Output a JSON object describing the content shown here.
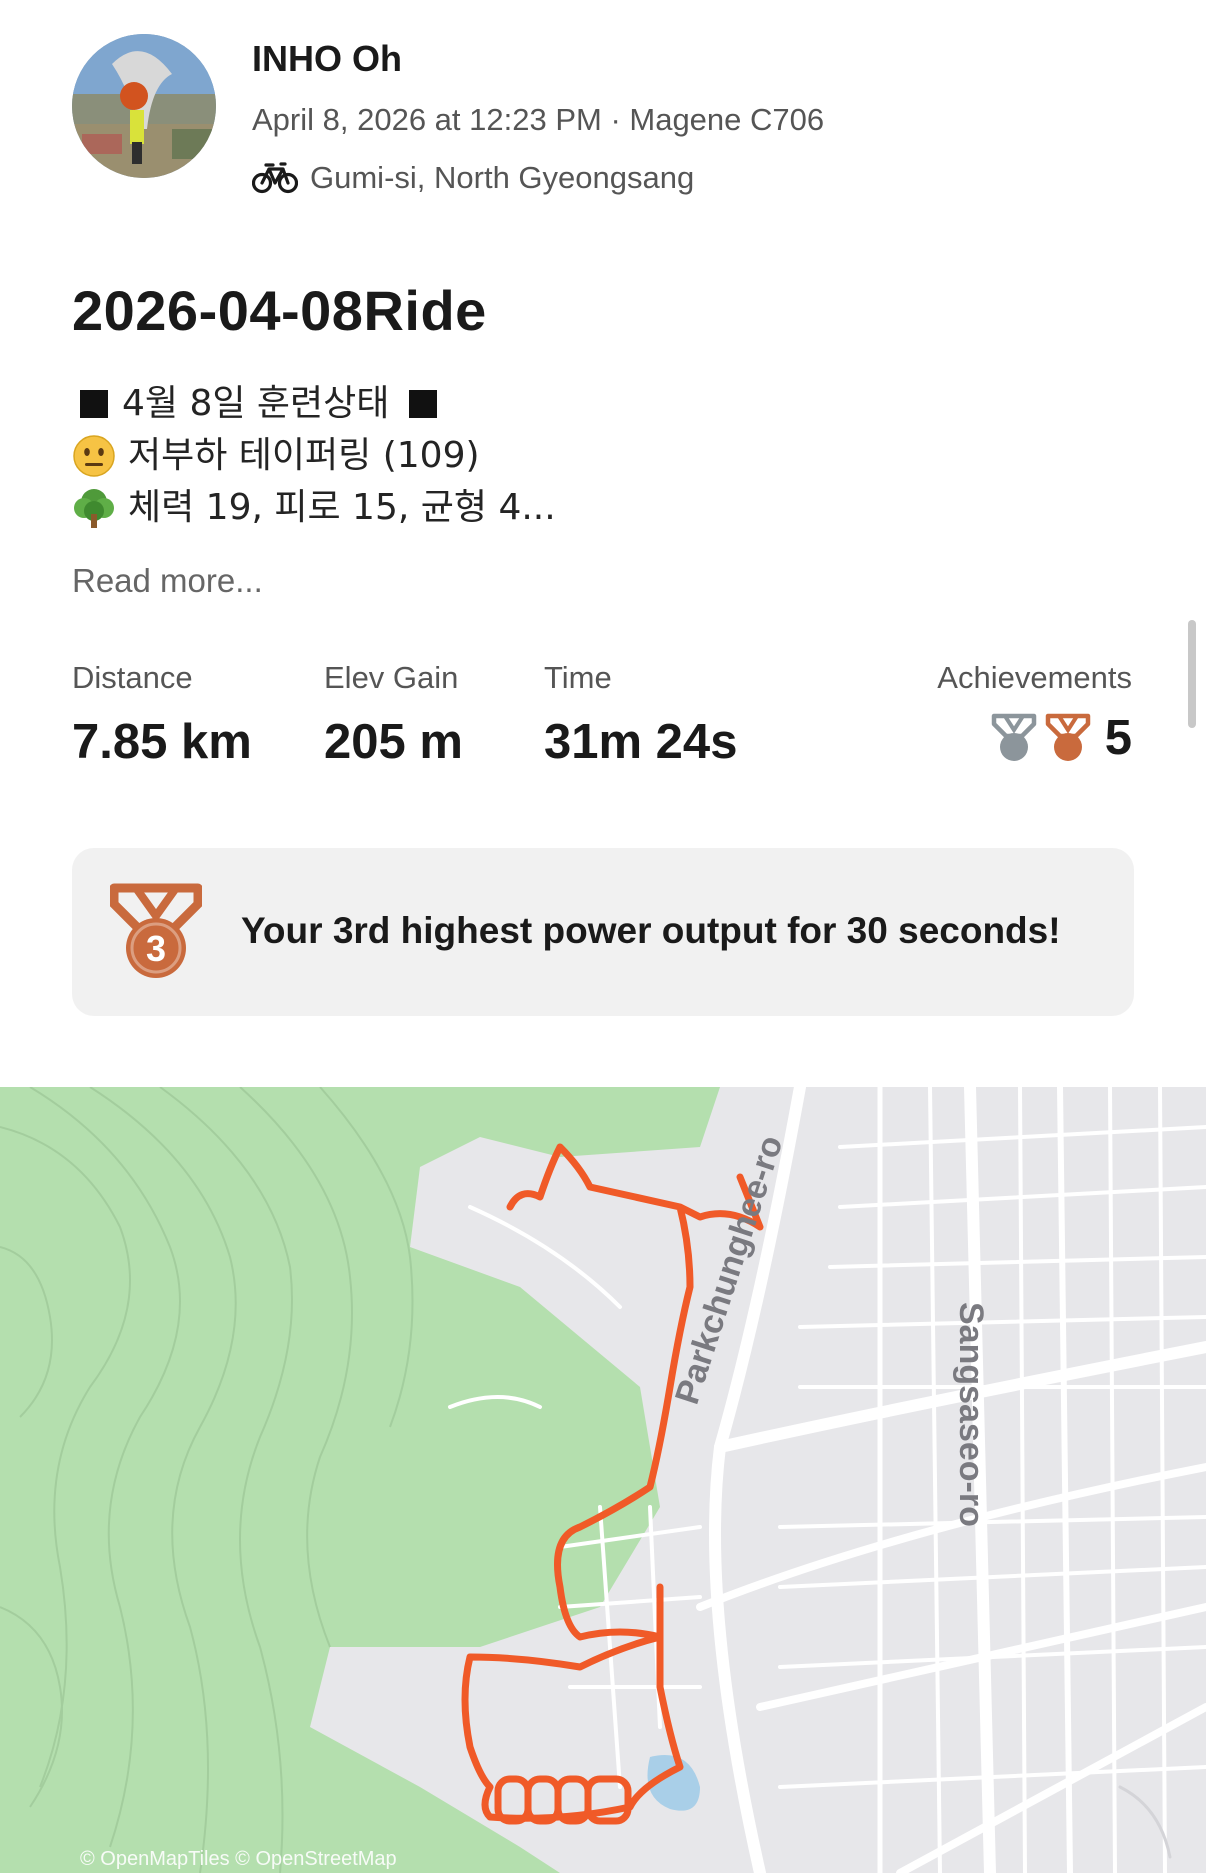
{
  "athlete": {
    "name": "INHO Oh",
    "meta": "April 8, 2026 at 12:23 PM · Magene C706",
    "location": "Gumi-si, North Gyeongsang"
  },
  "activity": {
    "title": "2026-04-08Ride",
    "description": {
      "line1": "4월 8일 훈련상태",
      "line2": "저부하 테이퍼링 (109)",
      "line3": "체력 19, 피로 15, 균형 4..."
    },
    "read_more": "Read more..."
  },
  "stats": {
    "distance": {
      "label": "Distance",
      "value": "7.85 km"
    },
    "elev_gain": {
      "label": "Elev Gain",
      "value": "205 m"
    },
    "time": {
      "label": "Time",
      "value": "31m 24s"
    },
    "achievements": {
      "label": "Achievements",
      "count": "5"
    }
  },
  "highlight": {
    "medal_number": "3",
    "text": "Your 3rd highest power output for 30 seconds!"
  },
  "map": {
    "road_labels": {
      "road1": "Parkchunghee-ro",
      "road2": "Sangsaseo-ro"
    },
    "attribution": "© OpenMapTiles © OpenStreetMap"
  },
  "colors": {
    "route": "#f05a28",
    "bronze": "#c96a3d",
    "silver": "#8c959b",
    "forest": "#b4dfae",
    "map_bg": "#e7e7ea"
  },
  "icons": {
    "sport": "bicycle-icon",
    "achievement_silver": "silver-medal-icon",
    "achievement_bronze": "bronze-medal-icon",
    "highlight": "bronze-medal-3-icon"
  }
}
